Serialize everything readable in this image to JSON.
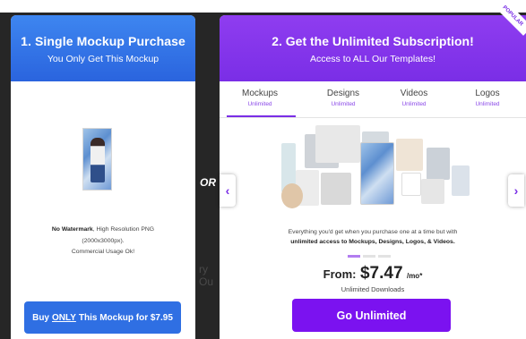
{
  "background": {
    "or_label": "OR",
    "faded_text": "ry Ou"
  },
  "single": {
    "title": "1. Single Mockup Purchase",
    "subtitle": "You Only Get This Mockup",
    "desc_bold": "No Watermark",
    "desc_rest": ", High Resolution PNG",
    "desc_line2": "(2000x3000px).",
    "desc_line3": "Commercial Usage Ok!",
    "button_pre": "Buy",
    "button_only": "ONLY",
    "button_post": "This Mockup for $7.95",
    "colors": {
      "header": "#2a64de",
      "button": "#2f6fe3"
    }
  },
  "subscription": {
    "badge": "POPULAR",
    "title": "2. Get the Unlimited Subscription!",
    "subtitle": "Access to ALL Our Templates!",
    "tabs": [
      {
        "label": "Mockups",
        "sub": "Unlimited",
        "active": true
      },
      {
        "label": "Designs",
        "sub": "Unlimited",
        "active": false
      },
      {
        "label": "Videos",
        "sub": "Unlimited",
        "active": false
      },
      {
        "label": "Logos",
        "sub": "Unlimited",
        "active": false
      }
    ],
    "desc_line1": "Everything you'd get when you purchase one at a time but with",
    "desc_line2_bold": "unlimited access to Mockups, Designs, Logos, & Videos.",
    "price_from": "From:",
    "price_amount": "$7.47",
    "price_unit": "/mo*",
    "unlimited_downloads": "Unlimited Downloads",
    "button": "Go Unlimited",
    "prev_icon": "‹",
    "next_icon": "›",
    "colors": {
      "header": "#7a2ee6",
      "button": "#7b12f0",
      "accent": "#8a48e8"
    }
  }
}
